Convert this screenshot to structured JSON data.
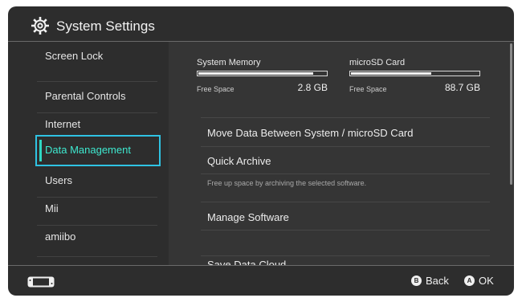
{
  "header": {
    "title": "System Settings",
    "icon": "gear-icon"
  },
  "sidebar": {
    "items": [
      {
        "label": "Screen Lock"
      },
      {
        "label": "Parental Controls"
      },
      {
        "label": "Internet"
      },
      {
        "label": "Data Management",
        "selected": true
      },
      {
        "label": "Users"
      },
      {
        "label": "Mii"
      },
      {
        "label": "amiibo"
      }
    ]
  },
  "storage": {
    "system": {
      "name": "System Memory",
      "free_label": "Free Space",
      "free_value": "2.8 GB",
      "used_fraction": 0.9
    },
    "sd": {
      "name": "microSD Card",
      "free_label": "Free Space",
      "free_value": "88.7 GB",
      "used_fraction": 0.63
    }
  },
  "content": {
    "move_data": "Move Data Between System / microSD Card",
    "quick_archive": "Quick Archive",
    "quick_archive_desc": "Free up space by archiving the selected software.",
    "manage_software": "Manage Software",
    "save_data_cloud": "Save Data Cloud"
  },
  "footer": {
    "back": {
      "key": "B",
      "label": "Back"
    },
    "ok": {
      "key": "A",
      "label": "OK"
    }
  },
  "colors": {
    "background": "#2d2d2d",
    "content_bg": "#353535",
    "accent": "#2fc3e3",
    "selected_text": "#3ee8cf"
  }
}
